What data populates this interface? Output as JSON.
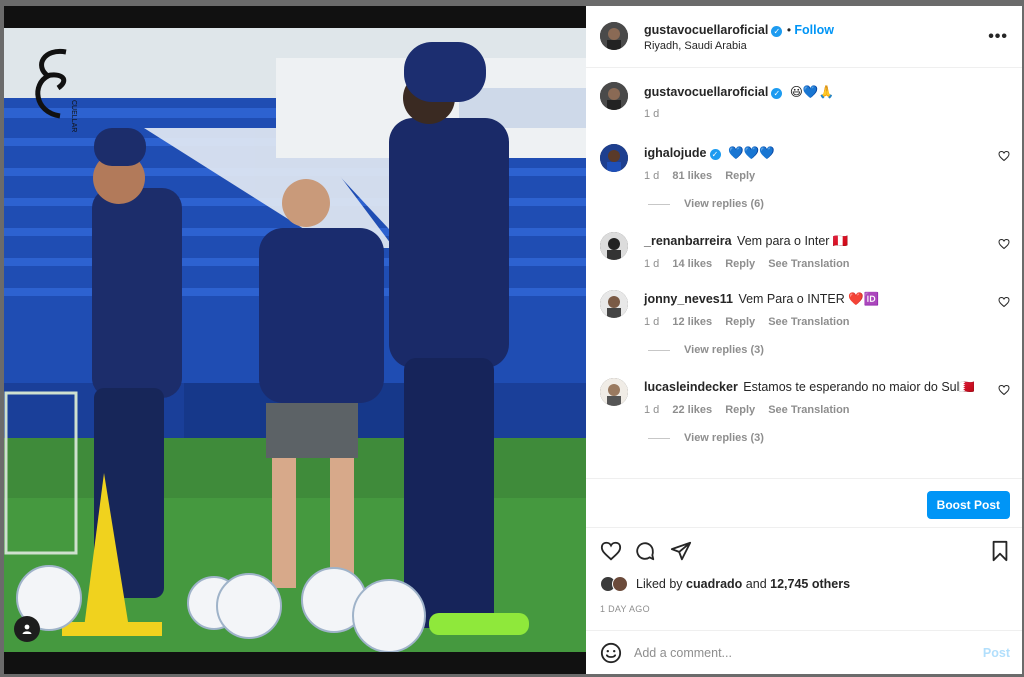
{
  "post": {
    "username": "gustavocuellaroficial",
    "follow_label": "Follow",
    "location": "Riyadh, Saudi Arabia",
    "more_label": "•••",
    "brand_mark": "CUELLAR"
  },
  "caption": {
    "username": "gustavocuellaroficial",
    "emojis": "😃💙🙏",
    "time": "1 d"
  },
  "comments": [
    {
      "username": "ighalojude",
      "verified": true,
      "text": "💙💙💙",
      "time": "1 d",
      "likes": "81 likes",
      "reply": "Reply",
      "translation": "",
      "view_replies": "View replies (6)"
    },
    {
      "username": "_renanbarreira",
      "verified": false,
      "text": "Vem para o Inter 🇵🇪",
      "time": "1 d",
      "likes": "14 likes",
      "reply": "Reply",
      "translation": "See Translation",
      "view_replies": ""
    },
    {
      "username": "jonny_neves11",
      "verified": false,
      "text": "Vem Para o INTER ❤️🆔",
      "time": "1 d",
      "likes": "12 likes",
      "reply": "Reply",
      "translation": "See Translation",
      "view_replies": "View replies (3)"
    },
    {
      "username": "lucasleindecker",
      "verified": false,
      "text": "Estamos te esperando no maior do Sul🇧🇭",
      "time": "1 d",
      "likes": "22 likes",
      "reply": "Reply",
      "translation": "See Translation",
      "view_replies": "View replies (3)"
    }
  ],
  "boost_label": "Boost Post",
  "likes_line": {
    "prefix": "Liked by",
    "user": "cuadrado",
    "middle": "and",
    "others": "12,745 others"
  },
  "time_ago": "1 DAY AGO",
  "add_comment": {
    "placeholder": "Add a comment...",
    "post_label": "Post"
  },
  "colors": {
    "accent": "#0095f6",
    "verified": "#1d9bf0",
    "heart_red": "#ed4956"
  }
}
